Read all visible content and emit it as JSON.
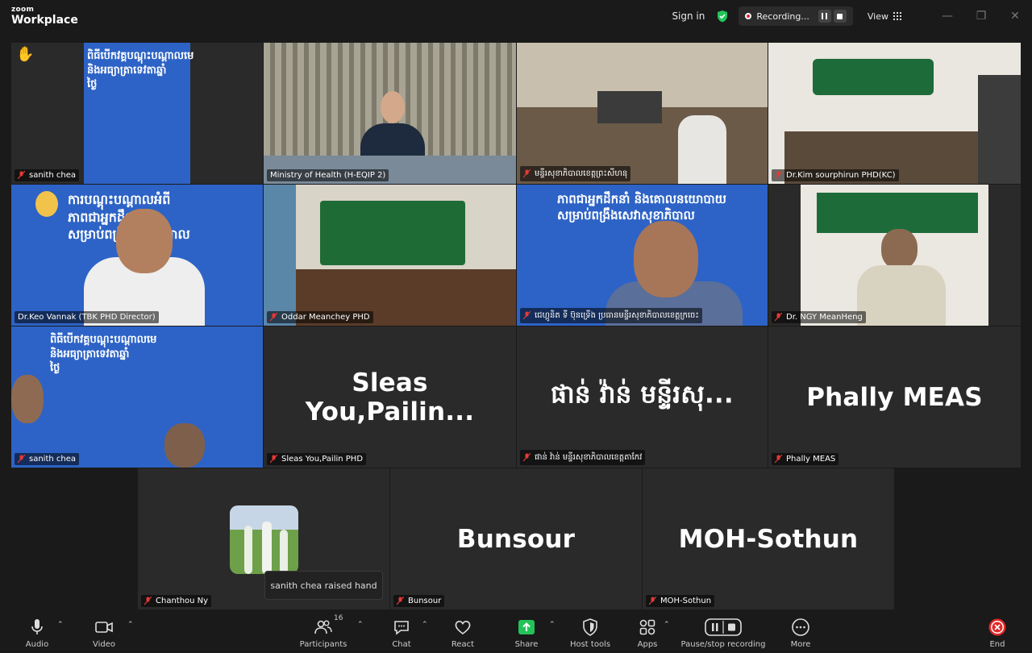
{
  "app": {
    "brand_top": "zoom",
    "brand_bottom": "Workplace"
  },
  "titlebar": {
    "signin_label": "Sign in",
    "recording_label": "Recording...",
    "view_label": "View"
  },
  "tiles": [
    {
      "name": "sanith chea",
      "slide": [
        "ពិធីបើកវគ្គបណ្តុះបណ្តាលមេ",
        "និងអធ្យាត្រាទេវតាឆ្នាំ",
        "ថ្ងៃ"
      ],
      "raised_hand": true
    },
    {
      "name": "Ministry of Health (H-EQIP 2)"
    },
    {
      "name": "មន្ទីរសុខាភិបាលខេត្តព្រះសីហនុ"
    },
    {
      "name": "Dr.Kim sourphirun PHD(KC)"
    },
    {
      "name": "Dr.Keo Vannak (TBK PHD Director)",
      "slide": [
        "ការបណ្តុះបណ្តាលអំពី",
        "ភាពជាអ្នកដឹកនាំ",
        "សម្រាប់ពង្រឹងសុខាភិបាល"
      ]
    },
    {
      "name": "Oddar Meanchey PHD"
    },
    {
      "name": "ជេហ្គូនិត ទី ប៊ុនទ្រើង ប្រធានមន្ទីរសុខាភិបាលខេត្តក្រចេះ",
      "slide": [
        "ភាពជាអ្នកដឹកនាំ និងគោលនយោបាយ",
        "សម្រាប់ពង្រឹងសេវាសុខាភិបាល"
      ]
    },
    {
      "name": "Dr. NGY MeanHeng"
    },
    {
      "name": "sanith chea",
      "slide": [
        "ពិធីបើកវគ្គបណ្តុះបណ្តាលមេ",
        "និងអធ្យាត្រាទេវតាឆ្នាំ",
        "ថ្ងៃ"
      ]
    },
    {
      "name": "Sleas You,Pailin PHD",
      "display": "Sleas  You,Pailin..."
    },
    {
      "name": "ផាន់ វ៉ាន់ មន្ទីរសុខាភិបាលខេត្តតាកែវ",
      "display": "ផាន់ វ៉ាន់ មន្ទីរសុ..."
    },
    {
      "name": "Phally MEAS",
      "display": "Phally MEAS"
    },
    {
      "name": "Chanthou Ny"
    },
    {
      "name": "Bunsour",
      "display": "Bunsour"
    },
    {
      "name": "MOH-Sothun",
      "display": "MOH-Sothun"
    }
  ],
  "tooltip": "sanith chea raised hand",
  "toolbar": {
    "audio": "Audio",
    "video": "Video",
    "participants": "Participants",
    "participants_count": "16",
    "chat": "Chat",
    "react": "React",
    "share": "Share",
    "host_tools": "Host tools",
    "apps": "Apps",
    "pause_stop": "Pause/stop recording",
    "more": "More",
    "end": "End"
  },
  "colors": {
    "share_green": "#23c35a",
    "active_border": "#3fdc8c",
    "end_red": "#e02828",
    "slide_blue": "#2d63c6"
  }
}
